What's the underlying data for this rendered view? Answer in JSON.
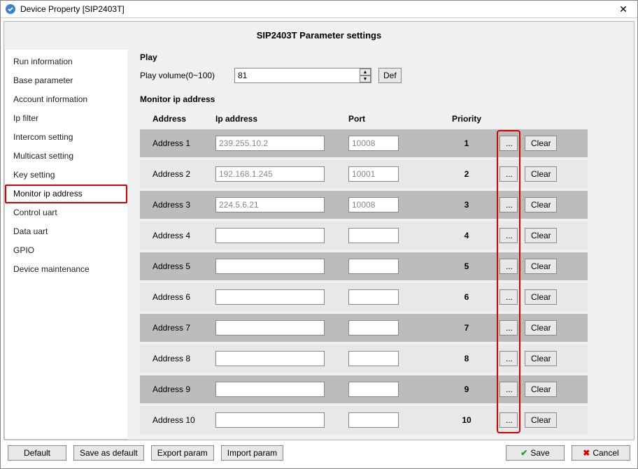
{
  "window": {
    "title": "Device Property [SIP2403T]"
  },
  "page_title": "SIP2403T Parameter settings",
  "sidebar": {
    "items": [
      {
        "label": "Run information"
      },
      {
        "label": "Base parameter"
      },
      {
        "label": "Account information"
      },
      {
        "label": "Ip filter"
      },
      {
        "label": "Intercom setting"
      },
      {
        "label": "Multicast setting"
      },
      {
        "label": "Key setting"
      },
      {
        "label": "Monitor ip address",
        "selected": true
      },
      {
        "label": "Control uart"
      },
      {
        "label": "Data uart"
      },
      {
        "label": "GPIO"
      },
      {
        "label": "Device maintenance"
      }
    ]
  },
  "play": {
    "section": "Play",
    "volume_label": "Play volume(0~100)",
    "volume_value": "81",
    "def_label": "Def"
  },
  "monitor": {
    "section": "Monitor ip address",
    "headers": {
      "address": "Address",
      "ip": "Ip address",
      "port": "Port",
      "priority": "Priority"
    },
    "dots_label": "...",
    "clear_label": "Clear",
    "rows": [
      {
        "label": "Address 1",
        "ip": "239.255.10.2",
        "port": "10008",
        "priority": "1"
      },
      {
        "label": "Address 2",
        "ip": "192.168.1.245",
        "port": "10001",
        "priority": "2"
      },
      {
        "label": "Address 3",
        "ip": "224.5.6.21",
        "port": "10008",
        "priority": "3"
      },
      {
        "label": "Address 4",
        "ip": "",
        "port": "",
        "priority": "4"
      },
      {
        "label": "Address 5",
        "ip": "",
        "port": "",
        "priority": "5"
      },
      {
        "label": "Address 6",
        "ip": "",
        "port": "",
        "priority": "6"
      },
      {
        "label": "Address 7",
        "ip": "",
        "port": "",
        "priority": "7"
      },
      {
        "label": "Address 8",
        "ip": "",
        "port": "",
        "priority": "8"
      },
      {
        "label": "Address 9",
        "ip": "",
        "port": "",
        "priority": "9"
      },
      {
        "label": "Address 10",
        "ip": "",
        "port": "",
        "priority": "10"
      }
    ]
  },
  "footer": {
    "default": "Default",
    "save_as_default": "Save as default",
    "export": "Export param",
    "import": "Import param",
    "save": "Save",
    "cancel": "Cancel"
  }
}
